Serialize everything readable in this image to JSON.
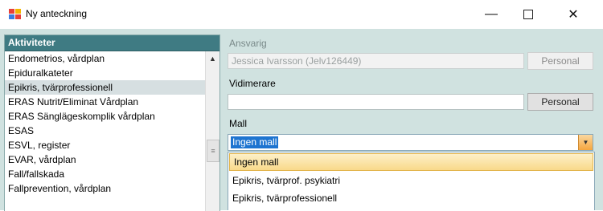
{
  "window": {
    "title": "Ny anteckning",
    "minimize_label": "—",
    "close_label": "✕"
  },
  "activities": {
    "header": "Aktiviteter",
    "items": [
      "Endometrios, vårdplan",
      "Epiduralkateter",
      "Epikris, tvärprofessionell",
      "ERAS Nutrit/Eliminat Vårdplan",
      "ERAS Sänglägeskomplik vårdplan",
      "ESAS",
      "ESVL, register",
      "EVAR, vårdplan",
      "Fall/fallskada",
      "Fallprevention, vårdplan"
    ],
    "selected_index": 2
  },
  "form": {
    "ansvarig_label": "Ansvarig",
    "ansvarig_value": "Jessica Ivarsson (Jelv126449)",
    "personal_button_1": "Personal",
    "vidimerare_label": "Vidimerare",
    "vidimerare_value": "",
    "personal_button_2": "Personal",
    "mall_label": "Mall",
    "mall_value": "Ingen mall",
    "mall_options": [
      "Ingen mall",
      "Epikris, tvärprof. psykiatri",
      "Epikris, tvärprofessionell"
    ]
  },
  "colors": {
    "background": "#d0e2e0",
    "list_header": "#3f7b83",
    "selection": "#1e74d0",
    "dropdown_highlight": "#f9d98a"
  }
}
